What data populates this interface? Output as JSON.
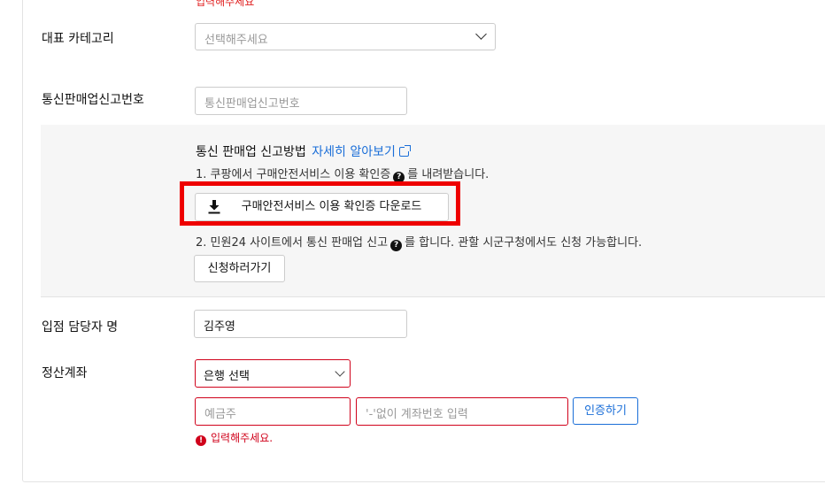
{
  "top_error": "입력해주세요",
  "category": {
    "label": "대표 카테고리",
    "placeholder": "선택해주세요"
  },
  "mail_order": {
    "label": "통신판매업신고번호",
    "placeholder": "통신판매업신고번호"
  },
  "guide": {
    "title": "통신 판매업 신고방법",
    "link": "자세히 알아보기",
    "step1_before": "1. 쿠팡에서 구매안전서비스 이용 확인증",
    "step1_after": "를 내려받습니다.",
    "download_button": "구매안전서비스 이용 확인증 다운로드",
    "step2_before": "2. 민원24 사이트에서 통신 판매업 신고",
    "step2_after": "를 합니다. 관할 시군구청에서도 신청 가능합니다.",
    "apply_button": "신청하러가기",
    "help_icon_glyph": "?"
  },
  "manager": {
    "label": "입점 담당자 명",
    "value": "김주영"
  },
  "settlement": {
    "label": "정산계좌",
    "bank_select_value": "은행 선택",
    "holder_placeholder": "예금주",
    "account_placeholder": "'-'없이 계좌번호 입력",
    "verify_button": "인증하기",
    "error_text": "입력해주세요.",
    "error_icon_glyph": "!"
  },
  "colors": {
    "accent": "#1a6ed8",
    "error": "#d0021b",
    "highlight_frame": "#ee0000",
    "guide_bg": "#f6f6f6"
  }
}
